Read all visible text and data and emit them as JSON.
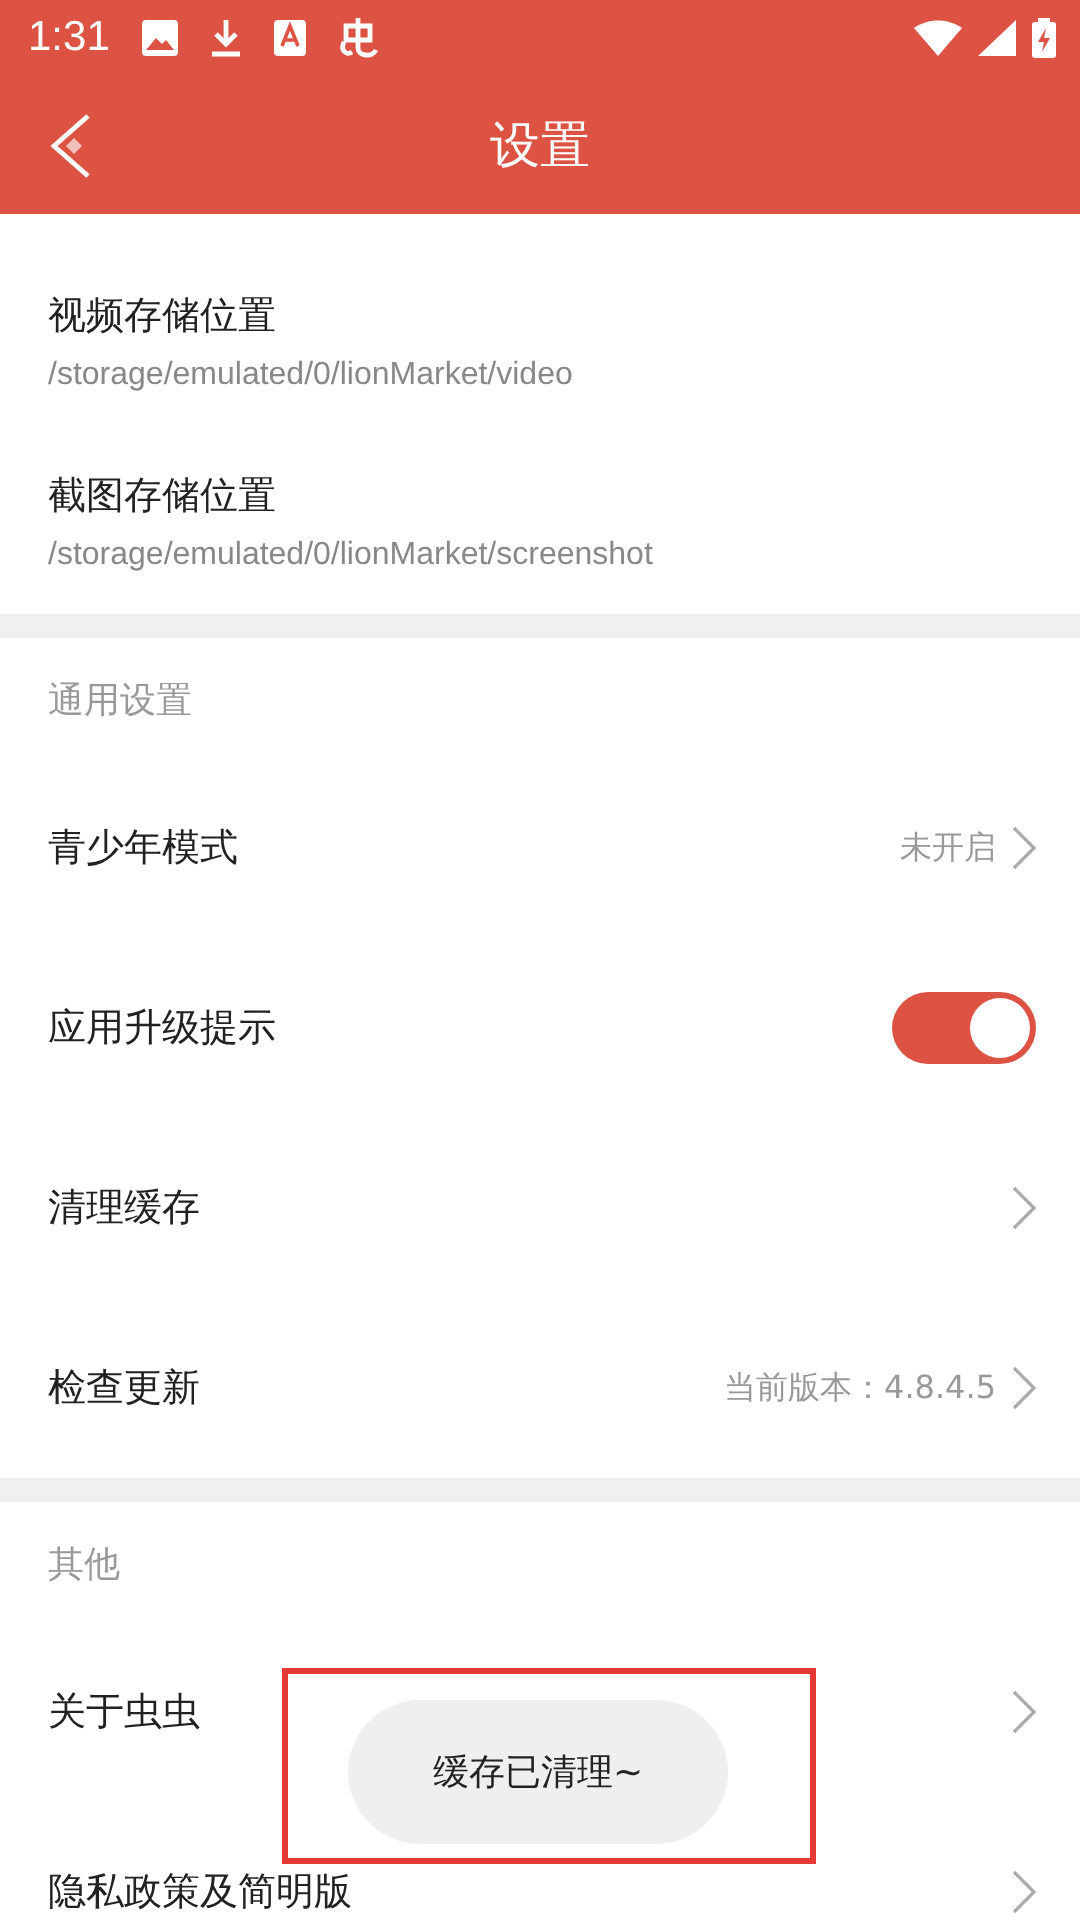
{
  "status_bar": {
    "time": "1:31"
  },
  "header": {
    "title": "设置"
  },
  "storage": [
    {
      "label": "视频存储位置",
      "path": "/storage/emulated/0/lionMarket/video"
    },
    {
      "label": "截图存储位置",
      "path": "/storage/emulated/0/lionMarket/screenshot"
    }
  ],
  "sections": [
    {
      "title": "通用设置",
      "items": [
        {
          "kind": "value",
          "label": "青少年模式",
          "value": "未开启"
        },
        {
          "kind": "toggle",
          "label": "应用升级提示",
          "on": true
        },
        {
          "kind": "link",
          "label": "清理缓存"
        },
        {
          "kind": "value",
          "label": "检查更新",
          "value": "当前版本：4.8.4.5"
        }
      ]
    },
    {
      "title": "其他",
      "items": [
        {
          "kind": "link",
          "label": "关于虫虫"
        },
        {
          "kind": "link",
          "label": "隐私政策及简明版"
        }
      ]
    }
  ],
  "toast": {
    "text": "缓存已清理~",
    "highlighted": true
  }
}
